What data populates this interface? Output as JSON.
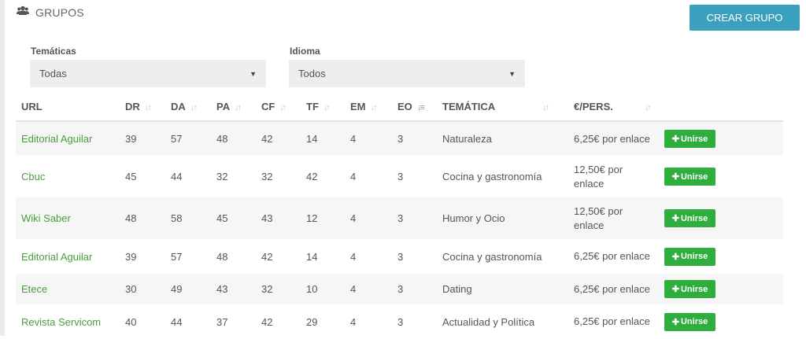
{
  "header": {
    "title": "GRUPOS",
    "icon": "users-icon"
  },
  "create_button": "CREAR GRUPO",
  "filters": {
    "tematicas": {
      "label": "Temáticas",
      "value": "Todas"
    },
    "idioma": {
      "label": "Idioma",
      "value": "Todos"
    }
  },
  "table": {
    "columns": [
      "URL",
      "DR",
      "DA",
      "PA",
      "CF",
      "TF",
      "EM",
      "EO",
      "TEMÁTICA",
      "€/PERS."
    ],
    "join_label": "Unirse",
    "rows": [
      {
        "url": "Editorial Aguilar",
        "dr": "39",
        "da": "57",
        "pa": "48",
        "cf": "42",
        "tf": "14",
        "em": "4",
        "eo": "3",
        "tematica": "Naturaleza",
        "price": "6,25€ por enlace"
      },
      {
        "url": "Cbuc",
        "dr": "45",
        "da": "44",
        "pa": "32",
        "cf": "32",
        "tf": "42",
        "em": "4",
        "eo": "3",
        "tematica": "Cocina y gastronomía",
        "price": "12,50€ por enlace"
      },
      {
        "url": "Wiki Saber",
        "dr": "48",
        "da": "58",
        "pa": "45",
        "cf": "43",
        "tf": "12",
        "em": "4",
        "eo": "3",
        "tematica": "Humor y Ocio",
        "price": "12,50€ por enlace"
      },
      {
        "url": "Editorial Aguilar",
        "dr": "39",
        "da": "57",
        "pa": "48",
        "cf": "42",
        "tf": "14",
        "em": "4",
        "eo": "3",
        "tematica": "Cocina y gastronomía",
        "price": "6,25€ por enlace"
      },
      {
        "url": "Etece",
        "dr": "30",
        "da": "49",
        "pa": "43",
        "cf": "32",
        "tf": "10",
        "em": "4",
        "eo": "3",
        "tematica": "Dating",
        "price": "6,25€ por enlace"
      },
      {
        "url": "Revista Servicom",
        "dr": "40",
        "da": "44",
        "pa": "37",
        "cf": "42",
        "tf": "29",
        "em": "4",
        "eo": "3",
        "tematica": "Actualidad y Política",
        "price": "6,25€ por enlace"
      }
    ]
  },
  "colors": {
    "accent": "#3aa0bd",
    "link": "#4a9d3e",
    "join": "#2eae3c"
  }
}
